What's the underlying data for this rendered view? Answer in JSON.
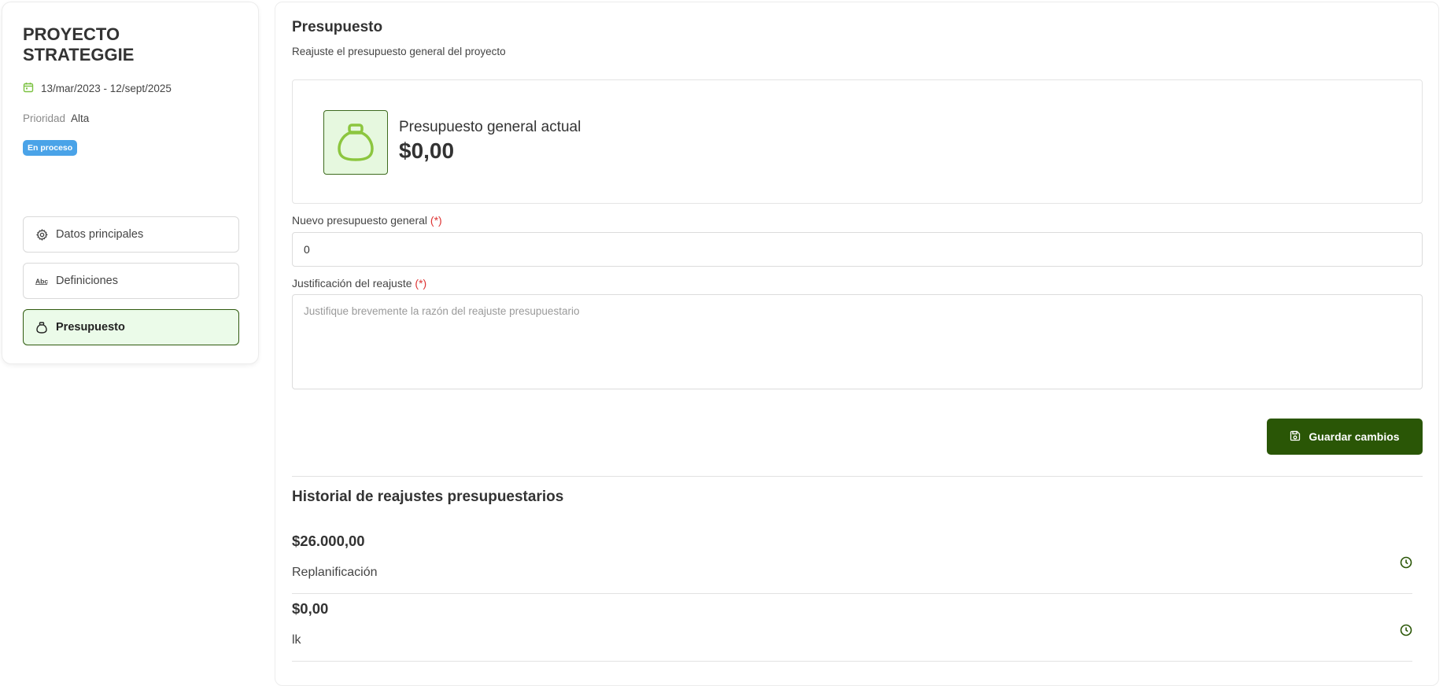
{
  "project": {
    "title": "PROYECTO STRATEGGIE",
    "dates": "13/mar/2023 - 12/sept/2025",
    "priority_label": "Prioridad",
    "priority_value": "Alta",
    "status_badge": "En proceso"
  },
  "nav": {
    "items": [
      {
        "label": "Datos principales",
        "icon": "gear-icon"
      },
      {
        "label": "Definiciones",
        "icon": "abc-icon"
      },
      {
        "label": "Presupuesto",
        "icon": "money-bag-icon",
        "active": true
      }
    ]
  },
  "budget": {
    "title": "Presupuesto",
    "subtitle": "Reajuste el presupuesto general del proyecto",
    "current_label": "Presupuesto general actual",
    "current_value": "$0,00",
    "new_label": "Nuevo presupuesto general",
    "required_mark": "(*)",
    "new_value": "0",
    "justification_label": "Justificación del reajuste",
    "justification_placeholder": "Justifique brevemente la razón del reajuste presupuestario",
    "save_label": "Guardar cambios"
  },
  "history": {
    "title": "Historial de reajustes presupuestarios",
    "entries": [
      {
        "amount": "$26.000,00",
        "reason": "Replanificación"
      },
      {
        "amount": "$0,00",
        "reason": "lk"
      }
    ]
  },
  "colors": {
    "primary": "#2a5606",
    "accent_green": "#8cc63f",
    "active_nav_bg": "#ebfbe9",
    "badge_blue": "#4aa3e8",
    "required_red": "#d33333"
  }
}
